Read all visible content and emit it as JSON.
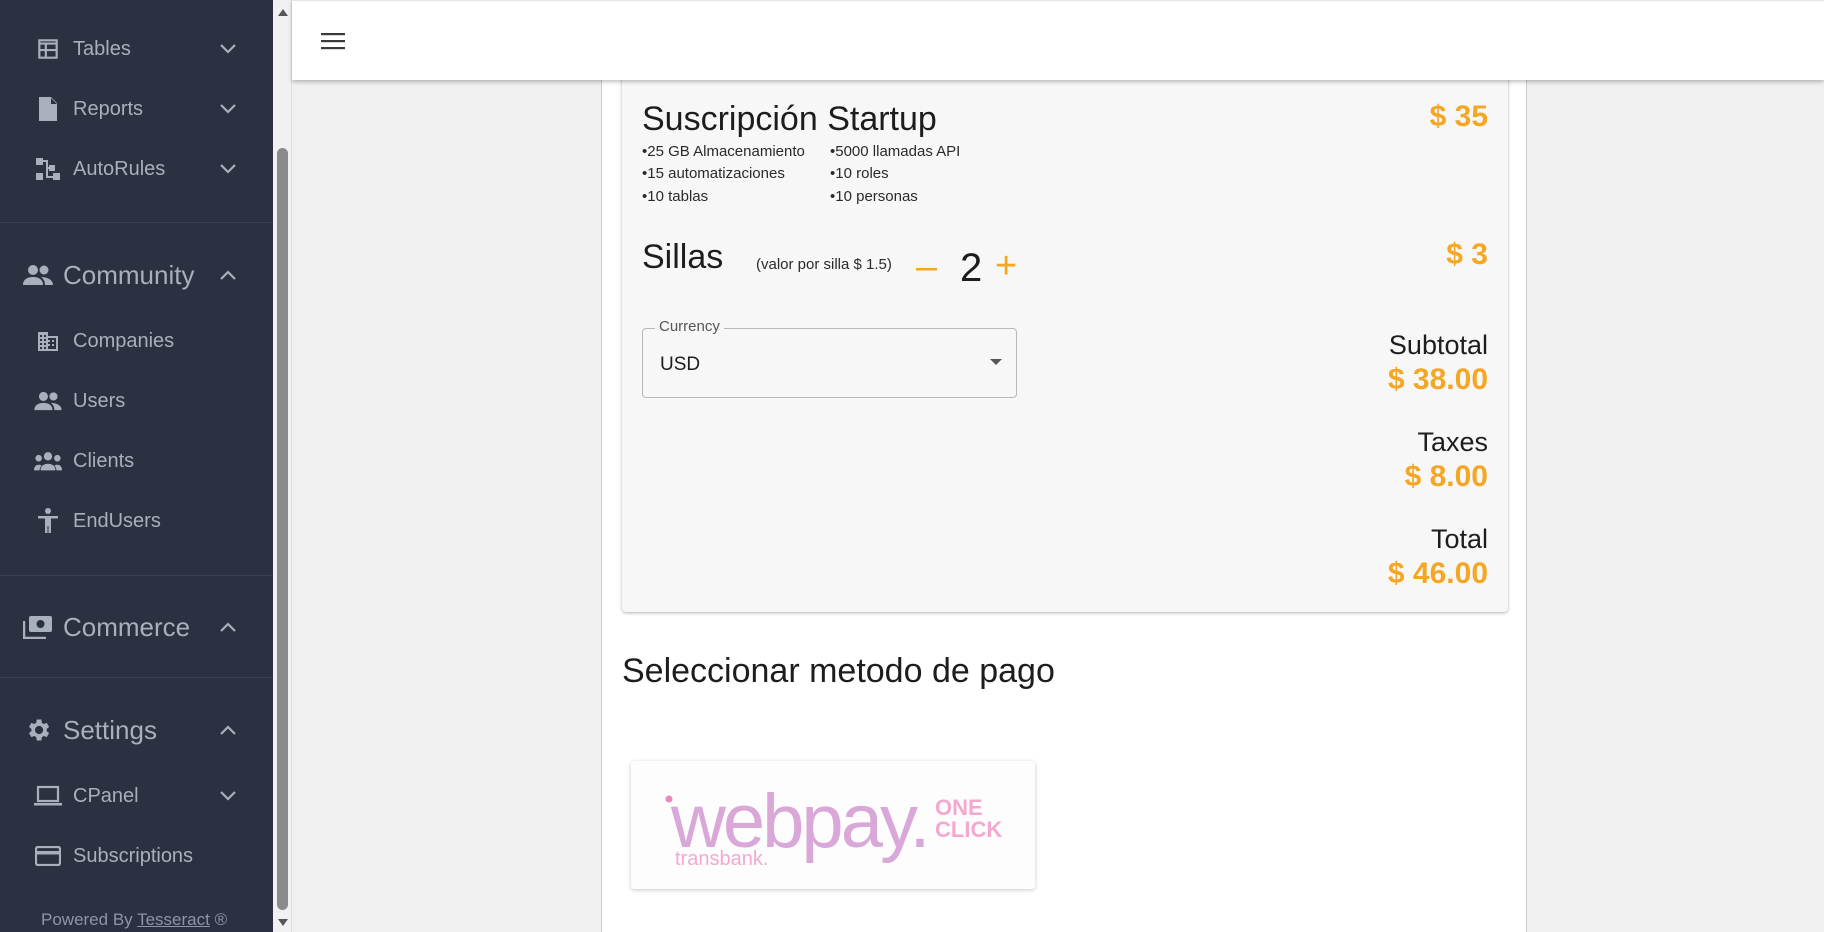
{
  "sidebar": {
    "items_top": [
      {
        "label": "Tables",
        "icon": "table-icon"
      },
      {
        "label": "Reports",
        "icon": "report-icon"
      },
      {
        "label": "AutoRules",
        "icon": "flow-icon"
      }
    ],
    "community": {
      "label": "Community",
      "items": [
        {
          "label": "Companies"
        },
        {
          "label": "Users"
        },
        {
          "label": "Clients"
        },
        {
          "label": "EndUsers"
        }
      ]
    },
    "commerce": {
      "label": "Commerce"
    },
    "settings": {
      "label": "Settings",
      "items": [
        {
          "label": "CPanel"
        },
        {
          "label": "Subscriptions"
        }
      ]
    },
    "powered_prefix": "Powered By",
    "powered_link": "Tesseract",
    "powered_suffix": "®"
  },
  "plan": {
    "title": "Suscripción Startup",
    "price": "$ 35",
    "features_left": [
      "•25 GB Almacenamiento",
      "•15 automatizaciones",
      "•10 tablas"
    ],
    "features_right": [
      "•5000 llamadas API",
      "•10 roles",
      "•10 personas"
    ]
  },
  "seats": {
    "title": "Sillas",
    "note": "(valor por silla $ 1.5)",
    "minus": "–",
    "count": "2",
    "plus": "+",
    "price": "$ 3"
  },
  "currency": {
    "label": "Currency",
    "value": "USD"
  },
  "totals": {
    "subtotal_label": "Subtotal",
    "subtotal_value": "$ 38.00",
    "taxes_label": "Taxes",
    "taxes_value": "$ 8.00",
    "total_label": "Total",
    "total_value": "$ 46.00"
  },
  "payment": {
    "title": "Seleccionar metodo de pago",
    "webpay_word": "webpay.",
    "webpay_one": "ONE",
    "webpay_click": "CLICK",
    "webpay_brand": "transbank."
  },
  "colors": {
    "sidebar_bg": "#2b3140",
    "accent": "#f5a623",
    "webpay_pink": "#d9a8d8"
  }
}
